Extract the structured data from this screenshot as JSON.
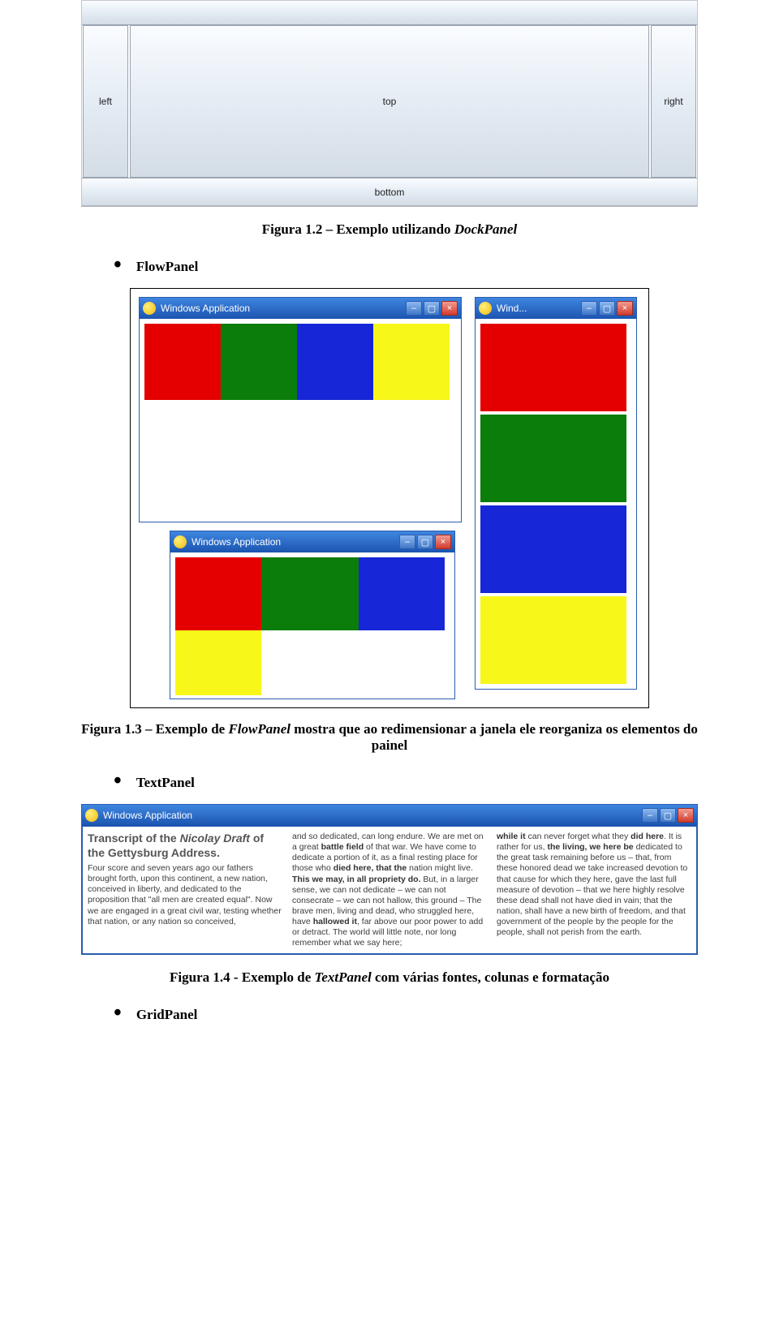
{
  "fig12": {
    "left": "left",
    "top": "top",
    "right": "right",
    "bottom": "bottom",
    "caption_prefix": "Figura 1.2 – Exemplo utilizando ",
    "caption_ital": "DockPanel"
  },
  "bullets": {
    "flowpanel": "FlowPanel",
    "textpanel": "TextPanel",
    "gridpanel": "GridPanel"
  },
  "fig13": {
    "window_title_full": "Windows Application",
    "window_title_short": "Wind...",
    "caption_a": "Figura 1.3 – Exemplo de ",
    "caption_ital": "FlowPanel",
    "caption_b": " mostra que ao redimensionar a janela ele reorganiza os elementos do painel"
  },
  "fig14": {
    "window_title": "Windows Application",
    "col1_heading_a": "Transcript of the ",
    "col1_heading_b": "Nicolay Draft",
    "col1_heading_c": " of the Gettysburg Address.",
    "col1_text": "Four score and seven years ago our fathers brought forth, upon this continent, a new nation, conceived in liberty, and dedicated to the proposition that \"all men are created equal\". Now we are engaged in a great civil war, testing whether that nation, or any nation so conceived,",
    "col2_pre": "and so dedicated, can long endure. We are met on a great ",
    "col2_b1": "battle field",
    "col2_mid1": " of that war. We have come to dedicate a portion of it, as a final resting place for those who ",
    "col2_b2": "died here, that the",
    "col2_mid2": " nation might live. ",
    "col2_b3": "This we may, in all propriety do.",
    "col2_mid3": " But, in a larger sense, we can not dedicate – we can not consecrate – we can not hallow, this ground – The brave men, living and dead, who struggled here, have ",
    "col2_b4": "hallowed it",
    "col2_end": ", far above our poor power to add or detract. The world will little note, nor long remember what we say here;",
    "col3_b1": "while it",
    "col3_a": " can never forget what they ",
    "col3_b2": "did here",
    "col3_b": ". It is rather for us, ",
    "col3_b3": "the living, we here be",
    "col3_c": " dedicated to the great task remaining before us – that, from these honored dead we take increased devotion to that cause for which they here, gave the last full measure of devotion – that we here highly resolve these dead shall not have died in vain; that the nation, shall have a new birth of freedom, and that government of the people by the people for the people, shall not perish from the earth.",
    "caption_a": "Figura 1.4 - Exemplo de ",
    "caption_ital": "TextPanel",
    "caption_b": " com várias fontes, colunas e formatação"
  }
}
